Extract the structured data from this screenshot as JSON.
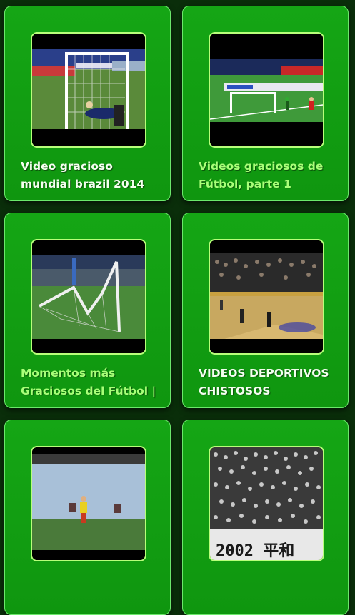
{
  "videos": [
    {
      "title": "Video gracioso mundial brazil 2014",
      "thumb": "goalkeeper-diving-thumbnail"
    },
    {
      "title": "Videos graciosos de Fútbol, parte 1",
      "thumb": "penalty-kick-thumbnail"
    },
    {
      "title": "Momentos más Graciosos del Fútbol |",
      "thumb": "broken-goal-net-thumbnail"
    },
    {
      "title": "VIDEOS DEPORTIVOS CHISTOSOS",
      "thumb": "basketball-court-thumbnail"
    },
    {
      "title": "",
      "thumb": "goalkeeper-yellow-kit-thumbnail"
    },
    {
      "title": "",
      "thumb": "stadium-crowd-thumbnail"
    }
  ],
  "thumb_texts": {
    "stadium_banner": "2002 平和"
  },
  "colors": {
    "card": "#12a012",
    "card_border": "#6be86b",
    "title_green": "#a8ff78",
    "title_white": "#f4fff0",
    "background": "#0a2e0a"
  }
}
